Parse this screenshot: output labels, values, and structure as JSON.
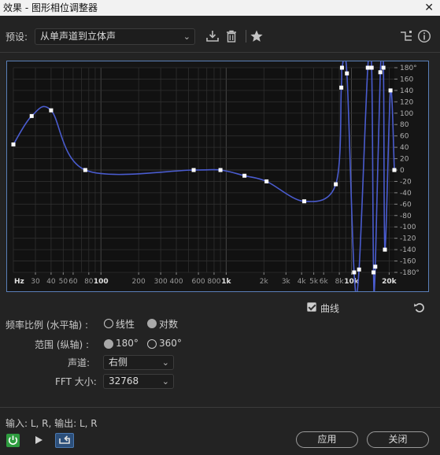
{
  "window": {
    "title": "效果 - 图形相位调整器",
    "close_glyph": "✕"
  },
  "preset": {
    "label": "预设:",
    "value": "从单声道到立体声"
  },
  "toolbar": {
    "save_icon": "download-save-icon",
    "delete_icon": "trash-icon",
    "favorite_icon": "star-icon",
    "routing_icon": "routing-icon",
    "info_icon": "info-icon"
  },
  "graph": {
    "x_axis_labels": [
      "Hz",
      "30",
      "40",
      "50",
      "60",
      "80",
      "100",
      "200",
      "300",
      "400",
      "600",
      "800",
      "1k",
      "2k",
      "3k",
      "4k",
      "5k",
      "6k",
      "8k",
      "10k",
      "20k"
    ],
    "x_axis_bold": [
      "Hz",
      "100",
      "1k",
      "10k",
      "20k"
    ],
    "y_axis_labels": [
      "180°",
      "160",
      "140",
      "120",
      "100",
      "80",
      "60",
      "40",
      "20",
      "0",
      "-20",
      "-40",
      "-60",
      "-80",
      "-100",
      "-120",
      "-140",
      "-160",
      "-180°"
    ],
    "x_range_hz": [
      20,
      22000
    ],
    "y_range_deg": [
      -180,
      180
    ],
    "x_scale": "log",
    "curve_color": "#4a5ccf",
    "grid_color": "#2f2f2f",
    "control_points": [
      {
        "hz": 20,
        "deg": 45
      },
      {
        "hz": 28,
        "deg": 95
      },
      {
        "hz": 40,
        "deg": 105
      },
      {
        "hz": 75,
        "deg": 0
      },
      {
        "hz": 550,
        "deg": 0
      },
      {
        "hz": 900,
        "deg": 0
      },
      {
        "hz": 1400,
        "deg": -10
      },
      {
        "hz": 2100,
        "deg": -20
      },
      {
        "hz": 4200,
        "deg": -55
      },
      {
        "hz": 7500,
        "deg": -25
      },
      {
        "hz": 8300,
        "deg": 145
      },
      {
        "hz": 8400,
        "deg": 180
      },
      {
        "hz": 9200,
        "deg": 170
      },
      {
        "hz": 10500,
        "deg": -180
      },
      {
        "hz": 11500,
        "deg": -175
      },
      {
        "hz": 13500,
        "deg": 180
      },
      {
        "hz": 14500,
        "deg": 180
      },
      {
        "hz": 15000,
        "deg": -180
      },
      {
        "hz": 15500,
        "deg": -170
      },
      {
        "hz": 17000,
        "deg": 172
      },
      {
        "hz": 18000,
        "deg": 180
      },
      {
        "hz": 18500,
        "deg": -140
      },
      {
        "hz": 20500,
        "deg": 140
      },
      {
        "hz": 22000,
        "deg": 0
      }
    ]
  },
  "curve_option": {
    "label": "曲线",
    "checked": true
  },
  "reset_icon": "reset-icon",
  "freq_scale": {
    "label": "频率比例 (水平轴) :",
    "options": [
      "线性",
      "对数"
    ],
    "selected": "对数"
  },
  "range": {
    "label": "范围 (纵轴) :",
    "options": [
      "180°",
      "360°"
    ],
    "selected": "180°"
  },
  "channel": {
    "label": "声道:",
    "value": "右侧"
  },
  "fft": {
    "label": "FFT 大小:",
    "value": "32768"
  },
  "io": {
    "text": "输入: L, R, 输出: L, R"
  },
  "buttons": {
    "apply": "应用",
    "close": "关闭"
  },
  "transport": {
    "power_icon": "power-icon",
    "play_icon": "play-icon",
    "loop_icon": "loop-icon"
  }
}
